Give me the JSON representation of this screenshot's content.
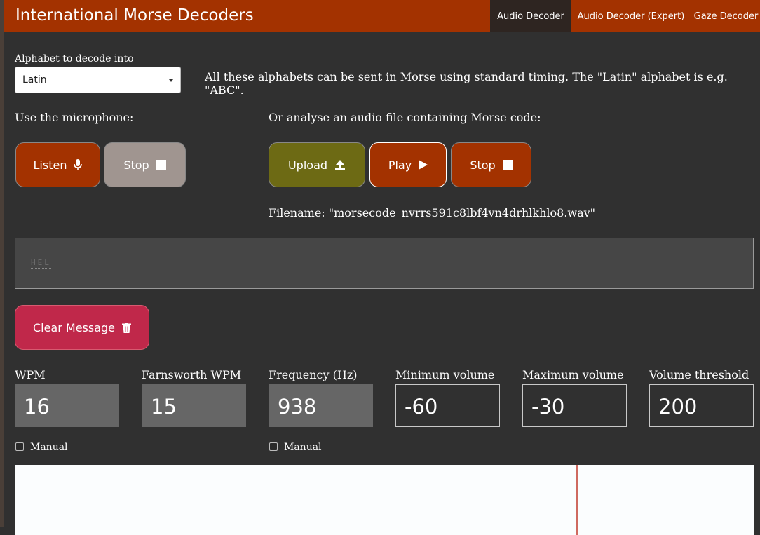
{
  "app_title": "International Morse Decoders",
  "nav": {
    "tabs": [
      {
        "label": "Audio Decoder",
        "active": true
      },
      {
        "label": "Audio Decoder (Expert)",
        "active": false
      },
      {
        "label": "Gaze Decoder",
        "active": false
      }
    ]
  },
  "alphabet": {
    "label": "Alphabet to decode into",
    "selected": "Latin",
    "description": "All these alphabets can be sent in Morse using standard timing. The \"Latin\" alphabet is e.g. \"ABC\"."
  },
  "mic": {
    "label": "Use the microphone:",
    "listen_label": "Listen",
    "stop_label": "Stop"
  },
  "file": {
    "label": "Or analyse an audio file containing Morse code:",
    "upload_label": "Upload",
    "play_label": "Play",
    "stop_label": "Stop",
    "filename_text": "Filename: \"morsecode_nvrrs591c8lbf4vn4drhlkhlo8.wav\""
  },
  "message": {
    "text": "HEL",
    "clear_label": "Clear Message"
  },
  "params": [
    {
      "label": "WPM",
      "value": "16"
    },
    {
      "label": "Farnsworth WPM",
      "value": "15"
    },
    {
      "label": "Frequency (Hz)",
      "value": "938"
    },
    {
      "label": "Minimum volume",
      "value": "-60"
    },
    {
      "label": "Maximum volume",
      "value": "-30"
    },
    {
      "label": "Volume threshold",
      "value": "200"
    }
  ],
  "manual_label": "Manual",
  "colors": {
    "navbar": "#a33200",
    "listen_button": "#a33200",
    "stop_disabled": "#a09590",
    "upload_button": "#6d6a14",
    "play_button": "#a33200",
    "clear_button": "#c0284a",
    "background": "#303030"
  },
  "icons": {
    "listen": "microphone-icon",
    "stop": "stop-square-icon",
    "upload": "upload-icon",
    "play": "play-icon",
    "clear": "trash-icon"
  }
}
